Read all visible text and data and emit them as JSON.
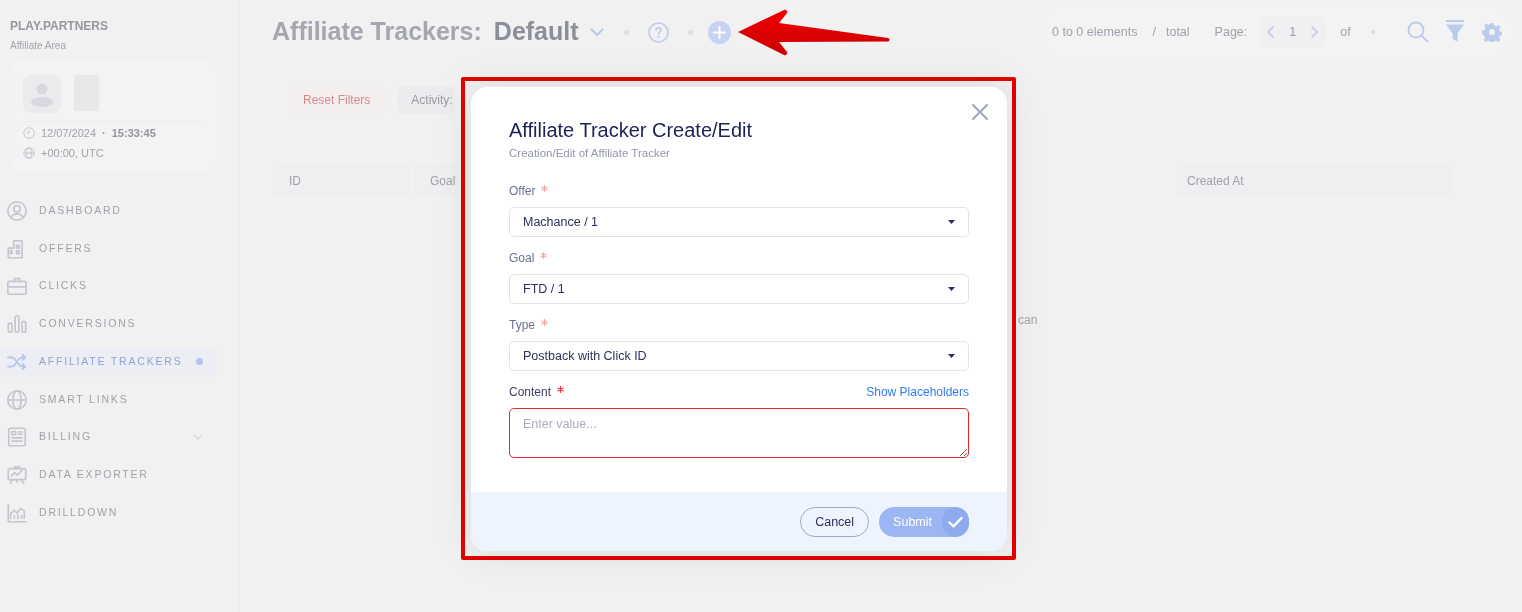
{
  "sidebar": {
    "brand": "PLAY.PARTNERS",
    "subtitle": "Affiliate Area",
    "date": "12/07/2024",
    "separator": "·",
    "time": "15:33:45",
    "timezone": "+00:00, UTC",
    "items": [
      {
        "label": "DASHBOARD",
        "kind": "link",
        "selected": false
      },
      {
        "label": "OFFERS",
        "kind": "link",
        "selected": false
      },
      {
        "label": "CLICKS",
        "kind": "link",
        "selected": false
      },
      {
        "label": "CONVERSIONS",
        "kind": "link",
        "selected": false
      },
      {
        "label": "AFFILIATE TRACKERS",
        "kind": "link",
        "selected": true
      },
      {
        "label": "SMART LINKS",
        "kind": "link",
        "selected": false
      },
      {
        "label": "BILLING",
        "kind": "group",
        "selected": false
      },
      {
        "label": "DATA EXPORTER",
        "kind": "link",
        "selected": false
      },
      {
        "label": "DRILLDOWN",
        "kind": "link",
        "selected": false
      }
    ]
  },
  "header": {
    "title": "Affiliate Trackers:",
    "view": "Default"
  },
  "pagination": {
    "range": "0 to 0 elements",
    "separator": "/",
    "total": "total",
    "page_label": "Page:",
    "page": "1",
    "of": "of"
  },
  "filters": [
    {
      "label": "Reset Filters",
      "kind": "reset"
    },
    {
      "label": "Activity:",
      "kind": "filter"
    }
  ],
  "table": {
    "columns": [
      "ID",
      "Goal",
      "Created At"
    ],
    "empty_text": "can"
  },
  "modal": {
    "title": "Affiliate Tracker Create/Edit",
    "subtitle": "Creation/Edit of Affiliate Tracker",
    "fields": [
      {
        "kind": "select",
        "label": "Offer",
        "required": true,
        "invalid": false,
        "value": "Machance / 1"
      },
      {
        "kind": "select",
        "label": "Goal",
        "required": true,
        "invalid": false,
        "value": "FTD / 1"
      },
      {
        "kind": "select",
        "label": "Type",
        "required": true,
        "invalid": false,
        "value": "Postback with Click ID"
      },
      {
        "kind": "textarea",
        "label": "Content",
        "required": true,
        "invalid": true,
        "placeholder": "Enter value...",
        "link": "Show Placeholders"
      }
    ],
    "buttons": [
      {
        "label": "Cancel",
        "kind": "secondary",
        "disabled": false
      },
      {
        "label": "Submit",
        "kind": "primary",
        "disabled": true
      }
    ]
  }
}
